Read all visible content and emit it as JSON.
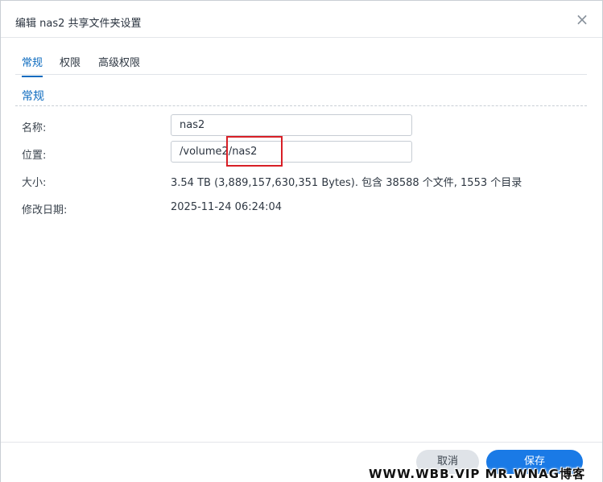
{
  "window": {
    "title": "编辑 nas2 共享文件夹设置",
    "close_symbol": "×"
  },
  "tabs": [
    {
      "label": "常规",
      "active": true
    },
    {
      "label": "权限",
      "active": false
    },
    {
      "label": "高级权限",
      "active": false
    }
  ],
  "section": {
    "title": "常规"
  },
  "fields": {
    "name_label": "名称:",
    "name_value": "nas2",
    "location_label": "位置:",
    "location_value": "/volume2/nas2",
    "size_label": "大小:",
    "size_value": "3.54 TB (3,889,157,630,351 Bytes). 包含 38588 个文件,  1553 个目录",
    "modified_label": "修改日期:",
    "modified_value": "2025-11-24 06:24:04"
  },
  "buttons": {
    "cancel": "取消",
    "save": "保存"
  },
  "watermark": "WWW.WBB.VIP   MR.WNAG博客",
  "colors": {
    "accent": "#0d6bbf",
    "primary_button": "#1a7ae6",
    "highlight": "#d81f26"
  }
}
